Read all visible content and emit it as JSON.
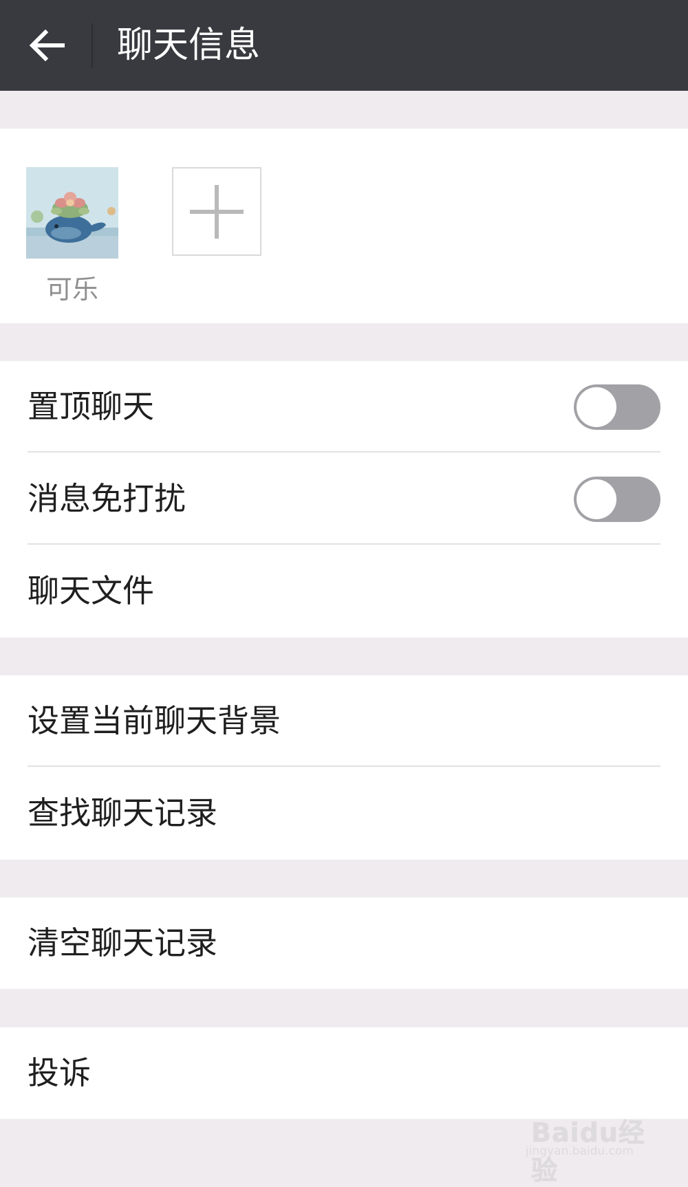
{
  "header": {
    "title": "聊天信息",
    "background_color": "#393a3f",
    "back_icon": "arrow-left-icon"
  },
  "members": [
    {
      "name": "可乐",
      "avatar_description_icon": "avatar-succulent-whale-icon"
    }
  ],
  "add_member_icon": "plus-icon",
  "settings": {
    "pin_chat": {
      "label": "置顶聊天",
      "on": false
    },
    "do_not_disturb": {
      "label": "消息免打扰",
      "on": false
    },
    "chat_files": {
      "label": "聊天文件"
    },
    "set_background": {
      "label": "设置当前聊天背景"
    },
    "search_history": {
      "label": "查找聊天记录"
    },
    "clear_history": {
      "label": "清空聊天记录"
    },
    "report": {
      "label": "投诉"
    }
  },
  "watermark": {
    "brand": "Baidu经验",
    "url": "jingyan.baidu.com"
  },
  "colors": {
    "page_background": "#efebef",
    "switch_off": "#a2a1a6"
  }
}
